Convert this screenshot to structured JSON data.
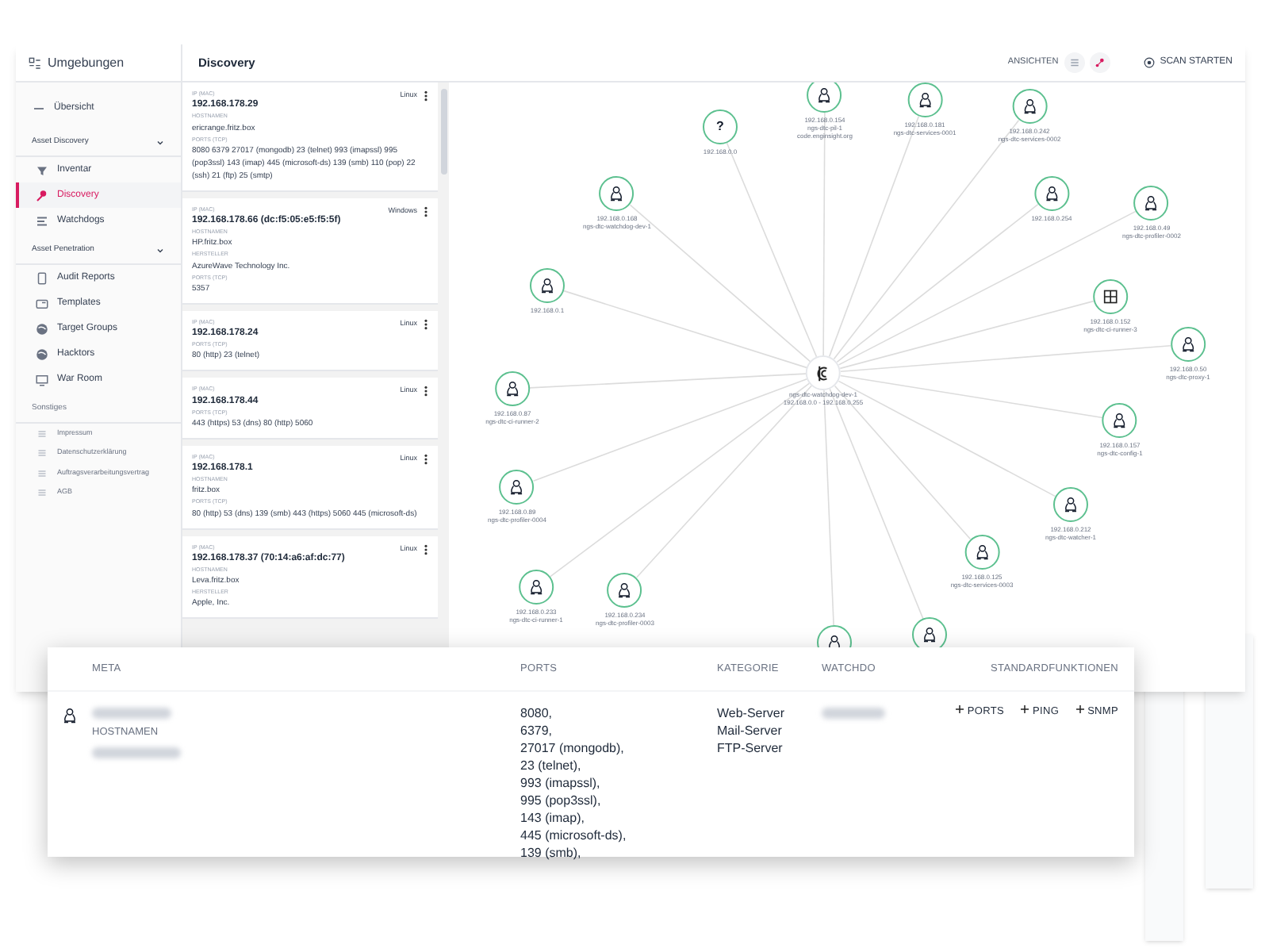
{
  "header": {
    "environment": "Umgebungen",
    "title": "Discovery",
    "views_label": "ANSICHTEN",
    "views": [
      {
        "kind": "list",
        "selected": false
      },
      {
        "kind": "graph",
        "selected": true
      }
    ],
    "scan_button": "SCAN STARTEN"
  },
  "sidebar": {
    "overview": {
      "label": "Übersicht",
      "kind": "dash"
    },
    "groups": [
      {
        "title": "Asset Discovery",
        "expanded": true,
        "muted": false,
        "items": [
          {
            "label": "Inventar",
            "kind": "funnel",
            "selected": false
          },
          {
            "label": "Discovery",
            "kind": "pin",
            "selected": true
          },
          {
            "label": "Watchdogs",
            "kind": "list",
            "selected": false
          }
        ]
      },
      {
        "title": "Asset Penetration",
        "expanded": true,
        "muted": false,
        "items": [
          {
            "label": "Audit Reports",
            "kind": "document",
            "selected": false
          },
          {
            "label": "Templates",
            "kind": "card",
            "selected": false
          },
          {
            "label": "Target Groups",
            "kind": "globe",
            "selected": false
          },
          {
            "label": "Hacktors",
            "kind": "globe",
            "selected": false
          },
          {
            "label": "War Room",
            "kind": "monitor",
            "selected": false
          }
        ]
      },
      {
        "title": "Sonstiges",
        "expanded": false,
        "muted": true,
        "items": [
          {
            "label": "Impressum",
            "kind": "lines",
            "selected": false
          },
          {
            "label": "Datenschutzerklärung",
            "kind": "lines",
            "selected": false
          },
          {
            "label": "Auftragsverarbeitungsvertrag",
            "kind": "lines",
            "selected": false
          },
          {
            "label": "AGB",
            "kind": "lines",
            "selected": false
          }
        ]
      }
    ]
  },
  "cards": [
    {
      "ip_label": "IP (MAC)",
      "ip": "192.168.178.29",
      "os": "Linux",
      "fields": [
        {
          "label": "HOSTNAMEN",
          "value": "ericrange.fritz.box"
        },
        {
          "label": "PORTS (TCP)",
          "value": "8080 6379 27017 (mongodb) 23 (telnet) 993 (imapssl) 995 (pop3ssl) 143 (imap) 445 (microsoft-ds) 139 (smb) 110 (pop) 22 (ssh) 21 (ftp) 25 (smtp)"
        }
      ]
    },
    {
      "ip_label": "IP (MAC)",
      "ip": "192.168.178.66 (dc:f5:05:e5:f5:5f)",
      "os": "Windows",
      "fields": [
        {
          "label": "HOSTNAMEN",
          "value": "HP.fritz.box"
        },
        {
          "label": "HERSTELLER",
          "value": "AzureWave Technology Inc."
        },
        {
          "label": "PORTS (TCP)",
          "value": "5357"
        }
      ]
    },
    {
      "ip_label": "IP (MAC)",
      "ip": "192.168.178.24",
      "os": "Linux",
      "fields": [
        {
          "label": "PORTS (TCP)",
          "value": "80 (http) 23 (telnet)"
        }
      ]
    },
    {
      "ip_label": "IP (MAC)",
      "ip": "192.168.178.44",
      "os": "Linux",
      "fields": [
        {
          "label": "PORTS (TCP)",
          "value": "443 (https) 53 (dns) 80 (http) 5060"
        }
      ]
    },
    {
      "ip_label": "IP (MAC)",
      "ip": "192.168.178.1",
      "os": "Linux",
      "fields": [
        {
          "label": "HOSTNAMEN",
          "value": "fritz.box"
        },
        {
          "label": "PORTS (TCP)",
          "value": "80 (http) 53 (dns) 139 (smb) 443 (https) 5060 445 (microsoft-ds)"
        }
      ]
    },
    {
      "ip_label": "IP (MAC)",
      "ip": "192.168.178.37 (70:14:a6:af:dc:77)",
      "os": "Linux",
      "fields": [
        {
          "label": "HOSTNAMEN",
          "value": "Leva.fritz.box"
        },
        {
          "label": "HERSTELLER",
          "value": "Apple, Inc."
        }
      ]
    }
  ],
  "graph": {
    "hub": {
      "labels": [
        "ngs-dtc-watchdog-dev-1",
        "192.168.0.0 - 192.168.0.255"
      ]
    },
    "nodes": [
      {
        "kind": "unknown",
        "symbol": "?",
        "labels": [
          "192.168.0.0"
        ]
      },
      {
        "kind": "linux",
        "labels": [
          "192.168.0.154",
          "ngs-dtc-pil-1",
          "code.enginsight.org"
        ]
      },
      {
        "kind": "linux",
        "labels": [
          "192.168.0.181",
          "ngs-dtc-services-0001"
        ]
      },
      {
        "kind": "linux",
        "labels": [
          "192.168.0.242",
          "ngs-dtc-services-0002"
        ]
      },
      {
        "kind": "linux",
        "labels": [
          "192.168.0.168",
          "ngs-dtc-watchdog-dev-1"
        ]
      },
      {
        "kind": "linux",
        "labels": [
          "192.168.0.254"
        ]
      },
      {
        "kind": "linux",
        "labels": [
          "192.168.0.49",
          "ngs-dtc-profiler-0002"
        ]
      },
      {
        "kind": "linux",
        "labels": [
          "192.168.0.1"
        ]
      },
      {
        "kind": "windows",
        "labels": [
          "192.168.0.152",
          "ngs-dtc-ci-runner-3"
        ]
      },
      {
        "kind": "linux",
        "labels": [
          "192.168.0.50",
          "ngs-dtc-proxy-1"
        ]
      },
      {
        "kind": "linux",
        "labels": [
          "192.168.0.87",
          "ngs-dtc-ci-runner-2"
        ]
      },
      {
        "kind": "linux",
        "labels": [
          "192.168.0.157",
          "ngs-dtc-config-1"
        ]
      },
      {
        "kind": "linux",
        "labels": [
          "192.168.0.89",
          "ngs-dtc-profiler-0004"
        ]
      },
      {
        "kind": "linux",
        "labels": [
          "192.168.0.212",
          "ngs-dtc-watcher-1"
        ]
      },
      {
        "kind": "linux",
        "labels": [
          "192.168.0.125",
          "ngs-dtc-services-0003"
        ]
      },
      {
        "kind": "linux",
        "labels": [
          "192.168.0.233",
          "ngs-dtc-ci-runner-1"
        ]
      },
      {
        "kind": "linux",
        "labels": [
          "192.168.0.234",
          "ngs-dtc-profiler-0003"
        ]
      },
      {
        "kind": "linux"
      },
      {
        "kind": "linux"
      }
    ]
  },
  "detail_table": {
    "columns": [
      "META",
      "PORTS",
      "KATEGORIE",
      "WATCHDO",
      "STANDARDFUNKTIONEN"
    ],
    "row": {
      "kind": "linux",
      "hostname_label": "HOSTNAMEN",
      "ports": [
        "8080,",
        "6379,",
        "27017 (mongodb),",
        "23 (telnet),",
        "993 (imapssl),",
        "995 (pop3ssl),",
        "143 (imap),",
        "445 (microsoft-ds),",
        "139 (smb),"
      ],
      "categories": [
        "Web-Server",
        "Mail-Server",
        "FTP-Server"
      ],
      "actions": [
        "PORTS",
        "PING",
        "SNMP"
      ]
    }
  }
}
